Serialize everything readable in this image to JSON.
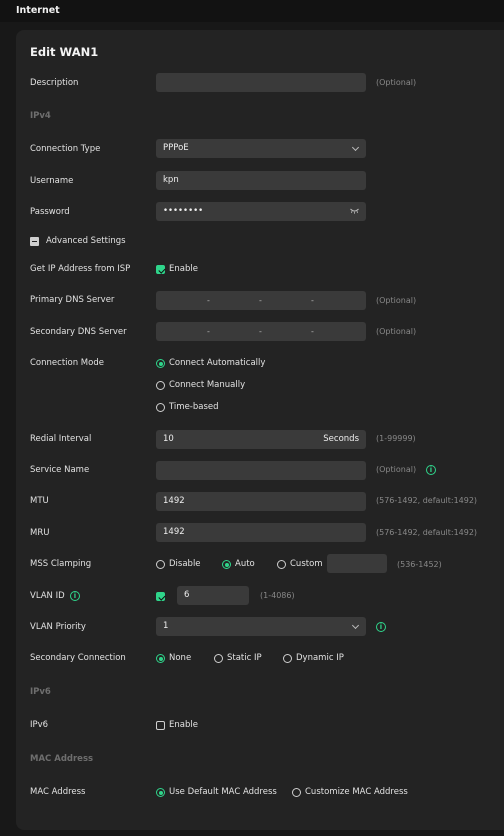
{
  "header": {
    "title": "Internet"
  },
  "card_title": "Edit WAN1",
  "labels": {
    "description": "Description",
    "ipv4": "IPv4",
    "connection_type": "Connection Type",
    "username": "Username",
    "password": "Password",
    "advanced": "Advanced Settings",
    "get_ip": "Get IP Address from ISP",
    "primary_dns": "Primary DNS Server",
    "secondary_dns": "Secondary DNS Server",
    "connection_mode": "Connection Mode",
    "redial": "Redial Interval",
    "service_name": "Service Name",
    "mtu": "MTU",
    "mru": "MRU",
    "mss": "MSS Clamping",
    "vlan_id": "VLAN ID",
    "vlan_priority": "VLAN Priority",
    "secondary_conn": "Secondary Connection",
    "ipv6_section": "IPv6",
    "ipv6": "IPv6",
    "mac_section": "MAC Address",
    "mac": "MAC Address"
  },
  "values": {
    "description": "",
    "connection_type": "PPPoE",
    "username": "kpn",
    "password": "••••••••",
    "redial": "10",
    "redial_unit": "Seconds",
    "service_name": "",
    "mtu": "1492",
    "mru": "1492",
    "mss_custom": "",
    "vlan_id": "6",
    "vlan_priority": "1"
  },
  "hints": {
    "optional": "(Optional)",
    "redial_range": "(1-99999)",
    "mtu_range": "(576-1492,  default:1492)",
    "mru_range": "(576-1492,  default:1492)",
    "mss_range": "(536-1452)",
    "vlan_range": "(1-4086)"
  },
  "options": {
    "enable": "Enable",
    "connect_auto": "Connect Automatically",
    "connect_manual": "Connect Manually",
    "time_based": "Time-based",
    "mss_disable": "Disable",
    "mss_auto": "Auto",
    "mss_custom": "Custom",
    "sec_none": "None",
    "sec_static": "Static IP",
    "sec_dynamic": "Dynamic IP",
    "ipv6_enable": "Enable",
    "mac_default": "Use Default MAC Address",
    "mac_custom": "Customize MAC Address"
  },
  "dns_separator": "-",
  "colors": {
    "accent": "#2fd58b",
    "background": "#181818",
    "card": "#232323",
    "input": "#3a3a3a"
  }
}
